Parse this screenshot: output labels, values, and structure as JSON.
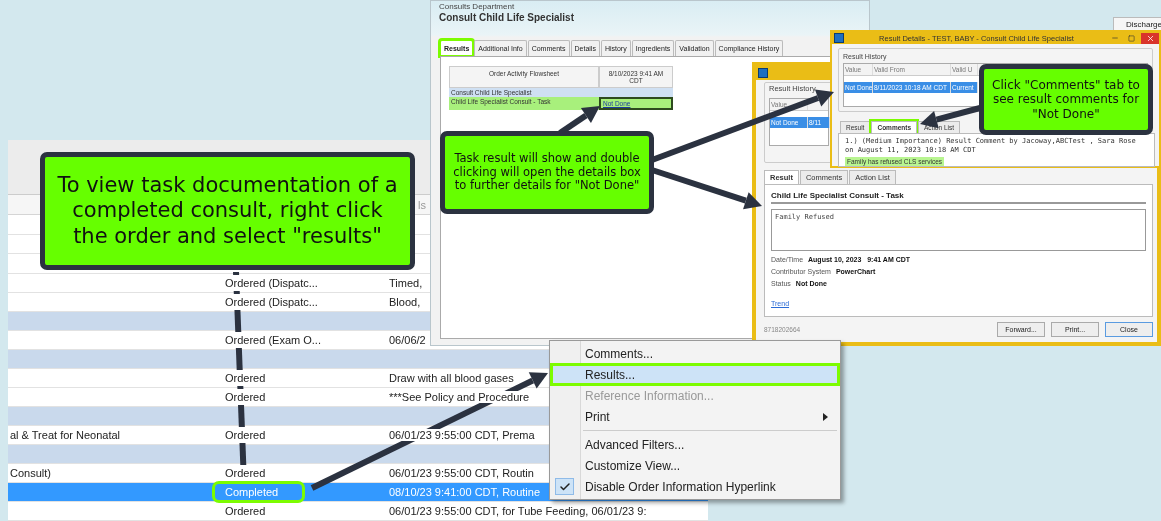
{
  "order_list": {
    "column_header": "ls",
    "rows": [
      {
        "kind": "order",
        "status": "Ordered (Dispatc...",
        "details": "Timed,",
        "selected": false,
        "highlighted": false
      },
      {
        "kind": "order",
        "status": "Ordered (Dispatc...",
        "details": "Blood,",
        "selected": false,
        "highlighted": false
      },
      {
        "kind": "group"
      },
      {
        "kind": "order",
        "status": "Ordered (Exam O...",
        "details": "06/06/2",
        "selected": false,
        "highlighted": false
      },
      {
        "kind": "group"
      },
      {
        "kind": "order",
        "status": "Ordered",
        "details": "Draw with all blood gases",
        "selected": false,
        "highlighted": false
      },
      {
        "kind": "order",
        "status": "Ordered",
        "details": "***See Policy and Procedure",
        "selected": false,
        "highlighted": false
      },
      {
        "kind": "group"
      },
      {
        "kind": "order",
        "name": "al & Treat for Neonatal",
        "status": "Ordered",
        "details": "06/01/23 9:55:00 CDT, Prema",
        "selected": false,
        "highlighted": false
      },
      {
        "kind": "group"
      },
      {
        "kind": "order",
        "name": "Consult)",
        "status": "Ordered",
        "details": "06/01/23 9:55:00 CDT, Routin",
        "selected": false,
        "highlighted": false
      },
      {
        "kind": "order",
        "status": "Completed",
        "details": "08/10/23 9:41:00 CDT, Routine",
        "selected": true,
        "highlighted": true
      },
      {
        "kind": "order",
        "status": "Ordered",
        "details": "06/01/23 9:55:00 CDT, for Tube Feeding, 06/01/23 9:",
        "selected": false,
        "highlighted": false
      }
    ]
  },
  "order_window": {
    "department": "Consults Department",
    "title": "Consult Child Life Specialist",
    "discharge_button": "Discharge",
    "tabs": [
      {
        "label": "Results",
        "selected": true,
        "highlighted": true
      },
      {
        "label": "Additional Info",
        "selected": false,
        "highlighted": false
      },
      {
        "label": "Comments",
        "selected": false,
        "highlighted": false
      },
      {
        "label": "Details",
        "selected": false,
        "highlighted": false
      },
      {
        "label": "History",
        "selected": false,
        "highlighted": false
      },
      {
        "label": "Ingredients",
        "selected": false,
        "highlighted": false
      },
      {
        "label": "Validation",
        "selected": false,
        "highlighted": false
      },
      {
        "label": "Compliance History",
        "selected": false,
        "highlighted": false
      }
    ],
    "flowsheet": {
      "column_1": "Order Activity Flowsheet",
      "column_2": "8/10/2023 9:41 AM CDT",
      "section": "Consult Child Life Specialist",
      "task": "Child Life Specialist Consult - Task",
      "value": "Not Done",
      "highlighted": true
    }
  },
  "result_window_back": {
    "history_title": "Result History",
    "history_column": "Value",
    "history_row": {
      "value": "Not Done",
      "valid_from": "8/11",
      "selected": true
    },
    "tabs": [
      {
        "label": "Result",
        "selected": true
      },
      {
        "label": "Comments",
        "selected": false
      },
      {
        "label": "Action List",
        "selected": false
      }
    ],
    "task_title": "Child Life Specialist Consult - Task",
    "result_text": "Family Refused",
    "fields": [
      {
        "label": "Date/Time",
        "value": "August 10, 2023   9:41 AM CDT"
      },
      {
        "label": "Contributor System",
        "value": "PowerChart"
      },
      {
        "label": "Status",
        "value": "Not Done"
      }
    ],
    "link": "Trend",
    "record_id": "8718202664",
    "buttons": [
      "Forward...",
      "Print...",
      "Close"
    ]
  },
  "result_window_front": {
    "title": "Result Details - TEST, BABY - Consult Child Life Specialist",
    "history_title": "Result History",
    "columns": [
      "Value",
      "Valid From",
      "Valid U"
    ],
    "row": {
      "cells": [
        "Not Done",
        "8/11/2023 10:18 AM CDT",
        "Current"
      ],
      "selected": true
    },
    "tabs": [
      {
        "label": "Result",
        "selected": false,
        "highlighted": false
      },
      {
        "label": "Comments",
        "selected": true,
        "highlighted": true
      },
      {
        "label": "Action List",
        "selected": false,
        "highlighted": false
      }
    ],
    "comment": "1.)  (Medium Importance) Result Comment by Jacoway,ABCTest , Sara Rose on August 11, 2023 10:18 AM CDT",
    "comment_note": "Family has refused CLS services"
  },
  "context_menu": {
    "items": [
      {
        "kind": "item",
        "label": "Comments...",
        "disabled": false,
        "selected": false,
        "highlighted": false,
        "checked": false,
        "submenu": false
      },
      {
        "kind": "item",
        "label": "Results...",
        "disabled": false,
        "selected": true,
        "highlighted": true,
        "checked": false,
        "submenu": false
      },
      {
        "kind": "item",
        "label": "Reference Information...",
        "disabled": true,
        "selected": false,
        "highlighted": false,
        "checked": false,
        "submenu": false
      },
      {
        "kind": "item",
        "label": "Print",
        "disabled": false,
        "selected": false,
        "highlighted": false,
        "checked": false,
        "submenu": true
      },
      {
        "kind": "separator"
      },
      {
        "kind": "item",
        "label": "Advanced Filters...",
        "disabled": false,
        "selected": false,
        "highlighted": false,
        "checked": false,
        "submenu": false
      },
      {
        "kind": "item",
        "label": "Customize View...",
        "disabled": false,
        "selected": false,
        "highlighted": false,
        "checked": false,
        "submenu": false
      },
      {
        "kind": "item",
        "label": "Disable Order Information Hyperlink",
        "disabled": false,
        "selected": false,
        "highlighted": false,
        "checked": true,
        "submenu": false
      }
    ]
  },
  "callouts": [
    "To view task documentation of a completed consult, right click the order and select \"results\"",
    "Task result will show and double clicking will open the details box to further details for \"Not Done\"",
    "Click \"Comments\" tab to see result comments for \"Not Done\""
  ]
}
